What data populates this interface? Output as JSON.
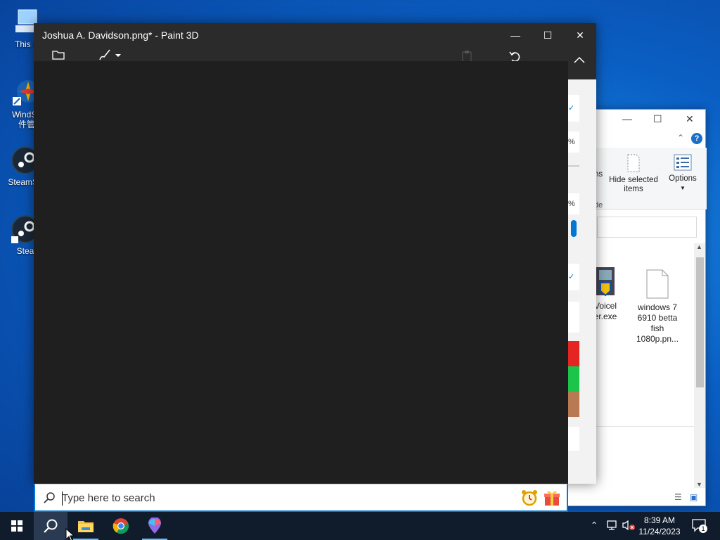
{
  "desktop": {
    "icons": [
      {
        "label": "This P",
        "icon": "this-pc-icon"
      },
      {
        "label": "WindSo\n件管",
        "icon": "windsoft-icon"
      },
      {
        "label": "SteamSe",
        "icon": "steam-icon"
      },
      {
        "label": "Stea",
        "icon": "steam-icon"
      }
    ]
  },
  "paint3d": {
    "title": "Joshua A. Davidson.png* - Paint 3D",
    "panel_values": [
      "%",
      "%"
    ],
    "swatch_colors": [
      "#e52521",
      "#1cc44a",
      "#b77a52"
    ]
  },
  "explorer": {
    "ribbon": {
      "partial_label": "ns",
      "hide_selected": "Hide selected items",
      "options": "Options",
      "section_label": "de"
    },
    "files": [
      {
        "name": "Voicel\ner.exe",
        "icon": "installer-icon"
      },
      {
        "name": "windows 7 6910 betta fish 1080p.pn...",
        "icon": "document-icon"
      }
    ]
  },
  "search": {
    "placeholder": "Type here to search"
  },
  "taskbar": {
    "apps": [
      "start-button",
      "search-button",
      "file-explorer",
      "chrome",
      "paint-3d"
    ],
    "time": "8:39 AM",
    "date": "11/24/2023",
    "notification_count": "1"
  }
}
